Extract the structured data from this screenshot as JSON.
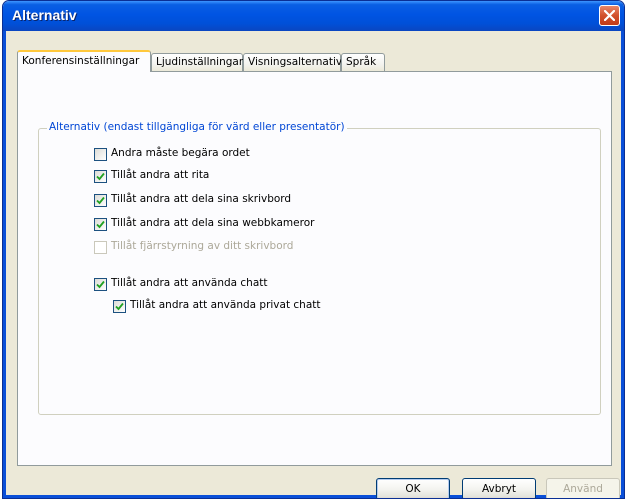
{
  "window": {
    "title": "Alternativ"
  },
  "tabs": [
    {
      "label": "Konferensinställningar",
      "active": true
    },
    {
      "label": "Ljudinställningar",
      "active": false
    },
    {
      "label": "Visningsalternativ",
      "active": false
    },
    {
      "label": "Språk",
      "active": false
    }
  ],
  "group": {
    "legend": "Alternativ (endast tillgängliga för värd eller presentatör)"
  },
  "options": [
    {
      "label": "Andra måste begära ordet",
      "checked": false,
      "enabled": true
    },
    {
      "label": "Tillåt andra att rita",
      "checked": true,
      "enabled": true
    },
    {
      "label": "Tillåt andra att dela sina skrivbord",
      "checked": true,
      "enabled": true
    },
    {
      "label": "Tillåt andra att dela sina webbkameror",
      "checked": true,
      "enabled": true
    },
    {
      "label": "Tillåt fjärrstyrning av ditt skrivbord",
      "checked": false,
      "enabled": false
    },
    {
      "label": "Tillåt andra att använda chatt",
      "checked": true,
      "enabled": true
    },
    {
      "label": "Tillåt andra att använda privat chatt",
      "checked": true,
      "enabled": true
    }
  ],
  "buttons": {
    "ok": "OK",
    "cancel": "Avbryt",
    "apply": "Använd"
  },
  "colors": {
    "titlebar": "#0054e3",
    "legend_text": "#0046d5",
    "active_tab_highlight": "#ffc83c",
    "checkmark": "#21a121"
  }
}
